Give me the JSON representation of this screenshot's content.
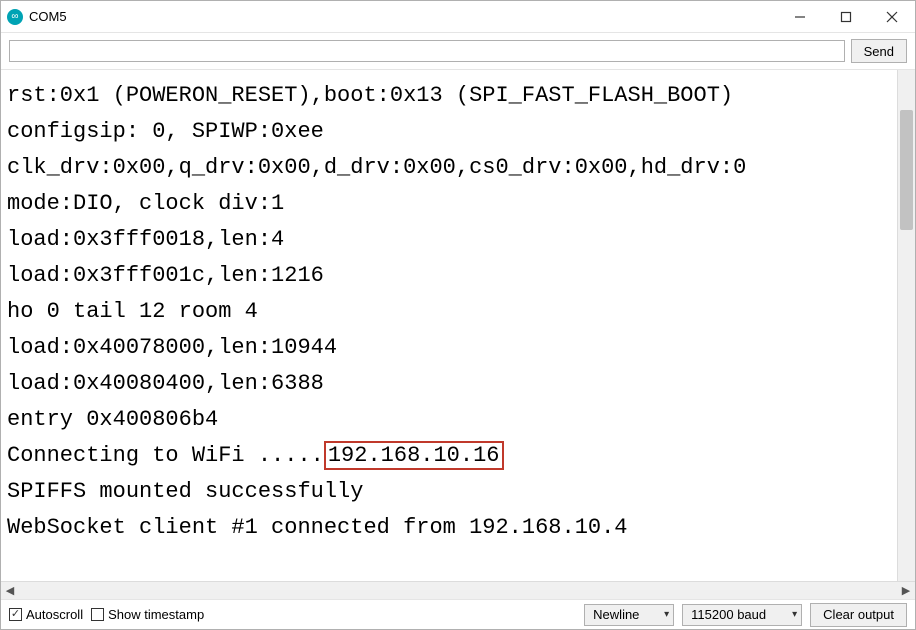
{
  "window": {
    "title": "COM5"
  },
  "toolbar": {
    "send_label": "Send",
    "input_value": ""
  },
  "console": {
    "lines": [
      "rst:0x1 (POWERON_RESET),boot:0x13 (SPI_FAST_FLASH_BOOT)",
      "configsip: 0, SPIWP:0xee",
      "clk_drv:0x00,q_drv:0x00,d_drv:0x00,cs0_drv:0x00,hd_drv:0",
      "mode:DIO, clock div:1",
      "load:0x3fff0018,len:4",
      "load:0x3fff001c,len:1216",
      "ho 0 tail 12 room 4",
      "load:0x40078000,len:10944",
      "load:0x40080400,len:6388",
      "entry 0x400806b4"
    ],
    "wifi_line_prefix": "Connecting to WiFi .....",
    "wifi_ip": "192.168.10.16",
    "post_lines": [
      "SPIFFS mounted successfully",
      "WebSocket client #1 connected from 192.168.10.4"
    ]
  },
  "footer": {
    "autoscroll_label": "Autoscroll",
    "autoscroll_checked": true,
    "timestamp_label": "Show timestamp",
    "timestamp_checked": false,
    "lineending_value": "Newline",
    "baud_value": "115200 baud",
    "clear_label": "Clear output"
  }
}
